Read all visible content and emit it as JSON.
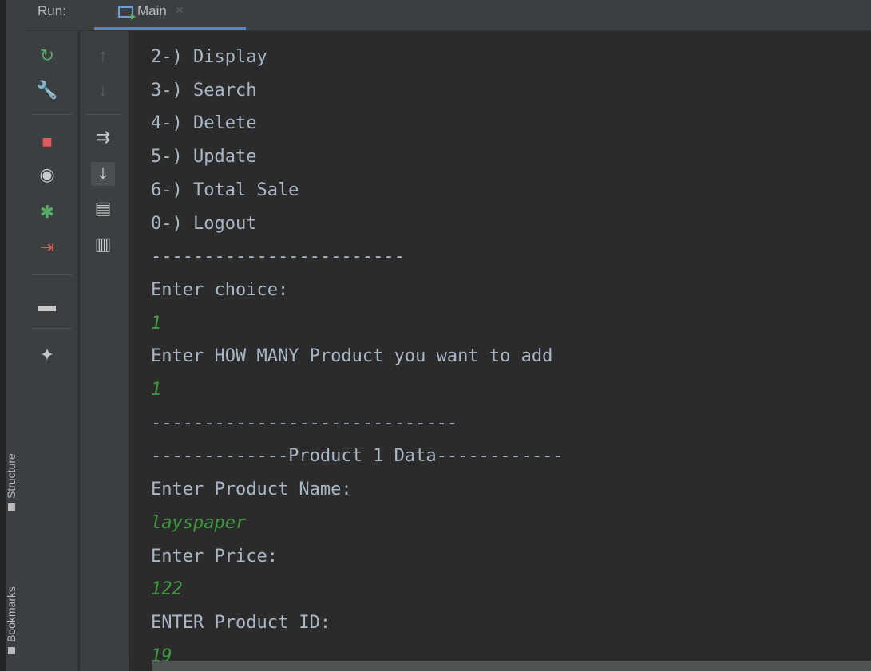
{
  "header": {
    "run_label": "Run:",
    "tab_label": "Main",
    "tab_close": "×"
  },
  "side_tabs": {
    "structure": "Structure",
    "bookmarks": "Bookmarks"
  },
  "toolbar_left": [
    {
      "name": "rerun-icon",
      "glyph": "↻",
      "color": "#59a869"
    },
    {
      "name": "wrench-icon",
      "glyph": "🔧",
      "color": "#c9c9c9"
    },
    {
      "name": "stop-icon",
      "glyph": "■",
      "color": "#db5c5c"
    },
    {
      "name": "camera-icon",
      "glyph": "◉",
      "color": "#c9c9c9"
    },
    {
      "name": "debug-bug-icon",
      "glyph": "✱",
      "color": "#59a869"
    },
    {
      "name": "exit-icon",
      "glyph": "⇥",
      "color": "#db5c5c"
    },
    {
      "name": "layout-icon",
      "glyph": "▬",
      "color": "#c9c9c9"
    },
    {
      "name": "pin-icon",
      "glyph": "✦",
      "color": "#c9c9c9"
    }
  ],
  "toolbar_right": [
    {
      "name": "scroll-up-icon",
      "glyph": "↑",
      "color": "#5e6060"
    },
    {
      "name": "scroll-down-icon",
      "glyph": "↓",
      "color": "#5e6060"
    },
    {
      "name": "soft-wrap-icon",
      "glyph": "⇉",
      "color": "#c9c9c9"
    },
    {
      "name": "scroll-to-end-icon",
      "glyph": "⤓",
      "color": "#c9c9c9"
    },
    {
      "name": "print-icon",
      "glyph": "▤",
      "color": "#c9c9c9"
    },
    {
      "name": "trash-icon",
      "glyph": "▥",
      "color": "#c9c9c9"
    }
  ],
  "console": {
    "lines": [
      {
        "text": "2-) Display",
        "kind": "out"
      },
      {
        "text": "3-) Search",
        "kind": "out"
      },
      {
        "text": "4-) Delete",
        "kind": "out"
      },
      {
        "text": "5-) Update",
        "kind": "out"
      },
      {
        "text": "6-) Total Sale",
        "kind": "out"
      },
      {
        "text": "0-) Logout",
        "kind": "out"
      },
      {
        "text": "------------------------",
        "kind": "out"
      },
      {
        "text": "Enter choice:",
        "kind": "out"
      },
      {
        "text": "1",
        "kind": "inp"
      },
      {
        "text": "Enter HOW MANY Product you want to add",
        "kind": "out"
      },
      {
        "text": "1",
        "kind": "inp"
      },
      {
        "text": "-----------------------------",
        "kind": "out"
      },
      {
        "text": "-------------Product 1 Data------------",
        "kind": "out"
      },
      {
        "text": "Enter Product Name:",
        "kind": "out"
      },
      {
        "text": "layspaper",
        "kind": "inp"
      },
      {
        "text": "Enter Price:",
        "kind": "out"
      },
      {
        "text": "122",
        "kind": "inp"
      },
      {
        "text": "ENTER Product ID:",
        "kind": "out"
      },
      {
        "text": "19",
        "kind": "inp"
      }
    ]
  }
}
